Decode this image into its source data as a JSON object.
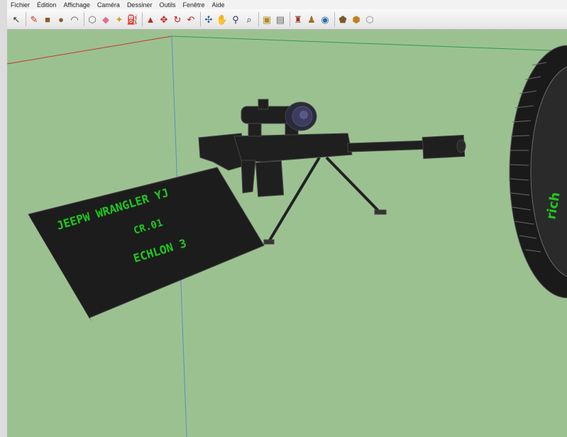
{
  "app": {
    "menus": [
      "Fichier",
      "Édition",
      "Affichage",
      "Caméra",
      "Dessiner",
      "Outils",
      "Fenêtre",
      "Aide"
    ]
  },
  "toolbar": {
    "groups": [
      [
        {
          "icon": "select-arrow-icon",
          "glyph": "↖",
          "color": "#333333"
        }
      ],
      [
        {
          "icon": "pencil-line-icon",
          "glyph": "✎",
          "color": "#c0392b"
        },
        {
          "icon": "rectangle-icon",
          "glyph": "■",
          "color": "#8b5a2b"
        },
        {
          "icon": "circle-icon",
          "glyph": "●",
          "color": "#8b5a2b"
        },
        {
          "icon": "arc-icon",
          "glyph": "◠",
          "color": "#444444"
        }
      ],
      [
        {
          "icon": "make-component-icon",
          "glyph": "⬡",
          "color": "#666666"
        },
        {
          "icon": "eraser-icon",
          "glyph": "◆",
          "color": "#e07090"
        },
        {
          "icon": "tape-measure-icon",
          "glyph": "✦",
          "color": "#caa020"
        },
        {
          "icon": "paint-bucket-icon",
          "glyph": "⛽",
          "color": "#5a4a2a"
        }
      ],
      [
        {
          "icon": "push-pull-icon",
          "glyph": "▲",
          "color": "#b03020"
        },
        {
          "icon": "move-icon",
          "glyph": "✥",
          "color": "#c02020"
        },
        {
          "icon": "rotate-icon",
          "glyph": "↻",
          "color": "#c02020"
        },
        {
          "icon": "offset-icon",
          "glyph": "↶",
          "color": "#c02020"
        }
      ],
      [
        {
          "icon": "orbit-icon",
          "glyph": "✣",
          "color": "#2a5aa0"
        },
        {
          "icon": "pan-hand-icon",
          "glyph": "✋",
          "color": "#444444"
        },
        {
          "icon": "zoom-icon",
          "glyph": "⚲",
          "color": "#2a3a6a"
        },
        {
          "icon": "zoom-extents-icon",
          "glyph": "⌕",
          "color": "#2a3a6a"
        }
      ],
      [
        {
          "icon": "previous-view-icon",
          "glyph": "▣",
          "color": "#b08a20"
        },
        {
          "icon": "next-view-icon",
          "glyph": "▤",
          "color": "#666666"
        }
      ],
      [
        {
          "icon": "position-camera-icon",
          "glyph": "♜",
          "color": "#a03020"
        },
        {
          "icon": "walk-icon",
          "glyph": "♟",
          "color": "#a07020"
        },
        {
          "icon": "look-around-icon",
          "glyph": "◉",
          "color": "#2a6ab0"
        }
      ],
      [
        {
          "icon": "get-models-icon",
          "glyph": "⬟",
          "color": "#7a5a2a"
        },
        {
          "icon": "share-model-icon",
          "glyph": "⬢",
          "color": "#c08020"
        },
        {
          "icon": "share-component-icon",
          "glyph": "⬡",
          "color": "#888888"
        }
      ]
    ]
  },
  "scene": {
    "plaque_lines": [
      "JEEPW WRANGLER YJ",
      "CR.01",
      "ECHLON 3"
    ],
    "tire_text": "rich",
    "colors": {
      "background": "#9cc191",
      "model": "#1f1f1f",
      "plaque_text": "#1ec81e"
    }
  }
}
